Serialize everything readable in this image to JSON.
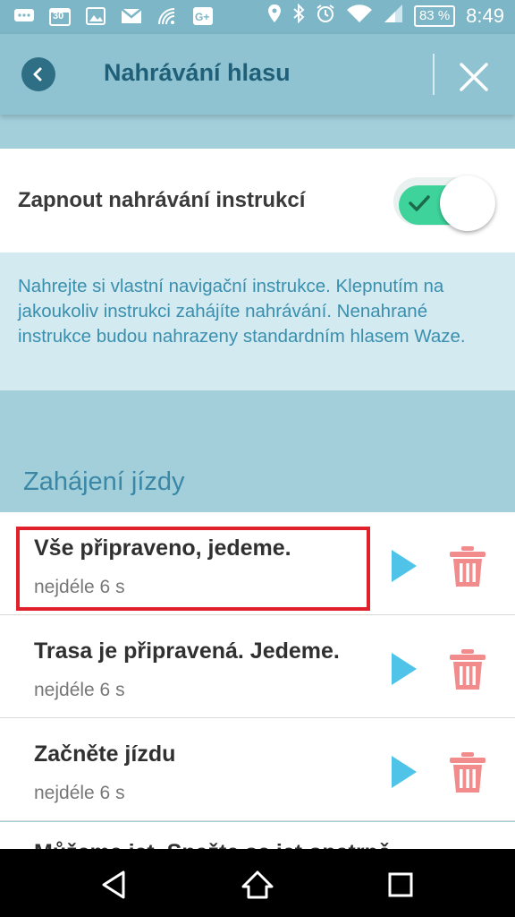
{
  "status_bar": {
    "calendar_day": "30",
    "battery": "83 %",
    "time": "8:49"
  },
  "app_bar": {
    "title": "Nahrávání hlasu"
  },
  "toggle_setting": {
    "label": "Zapnout nahrávání instrukcí",
    "enabled": true
  },
  "info": {
    "text": "Nahrejte si vlastní navigační instrukce. Klepnutím na jakoukoliv instrukci zahájíte nahrávání. Nenahrané instrukce budou nahrazeny standardním hlasem Waze."
  },
  "section": {
    "title": "Zahájení jízdy"
  },
  "items": [
    {
      "title": "Vše připraveno, jedeme.",
      "subtitle": "nejdéle 6 s"
    },
    {
      "title": "Trasa je připravená. Jedeme.",
      "subtitle": "nejdéle 6 s"
    },
    {
      "title": "Začněte jízdu",
      "subtitle": "nejdéle 6 s"
    }
  ],
  "partial_item": {
    "title": "Můžeme jet. Snažte se jet opatrně."
  },
  "colors": {
    "accent": "#2e6f86",
    "play": "#4fc3e8",
    "trash": "#f28b8b",
    "toggle_on": "#3ed39b",
    "highlight": "#e0202a"
  }
}
